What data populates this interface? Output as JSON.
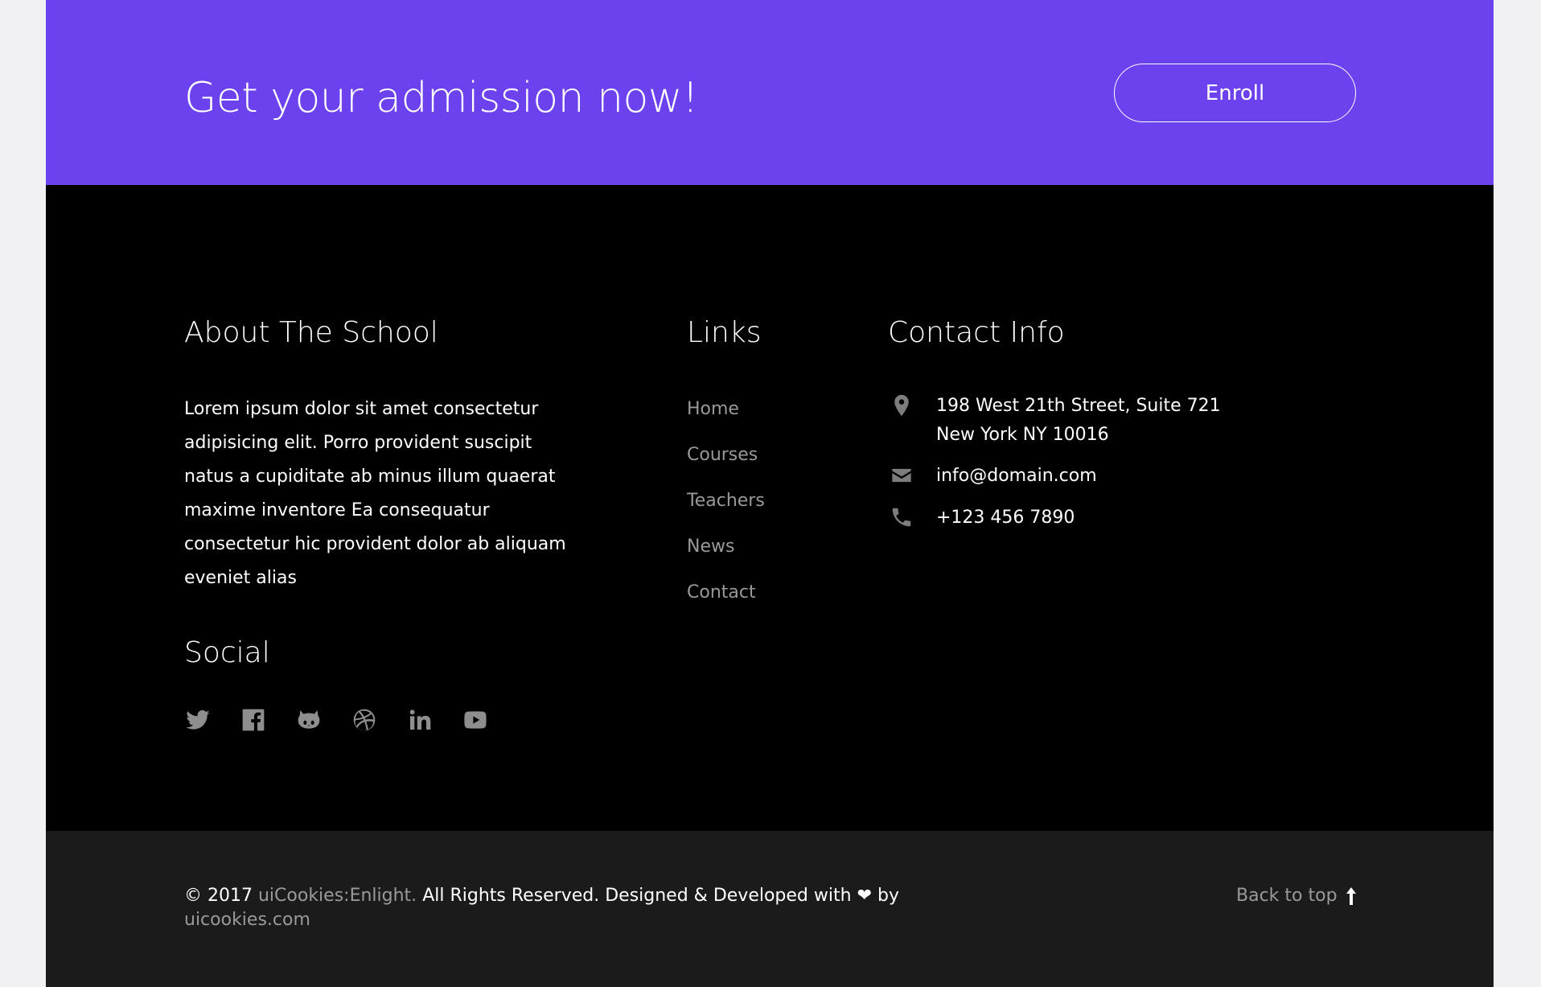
{
  "cta": {
    "title": "Get your admission now!",
    "button_label": "Enroll"
  },
  "about": {
    "heading": "About The School",
    "text": "Lorem ipsum dolor sit amet consectetur adipisicing elit. Porro provident suscipit natus a cupiditate ab minus illum quaerat maxime inventore Ea consequatur consectetur hic provident dolor ab aliquam eveniet alias"
  },
  "social": {
    "heading": "Social",
    "icons": [
      "twitter-icon",
      "facebook-icon",
      "github-icon",
      "dribbble-icon",
      "linkedin-icon",
      "youtube-icon"
    ]
  },
  "links": {
    "heading": "Links",
    "items": [
      "Home",
      "Courses",
      "Teachers",
      "News",
      "Contact"
    ]
  },
  "contact": {
    "heading": "Contact Info",
    "address": "198 West 21th Street, Suite 721 New York NY 10016",
    "email": "info@domain.com",
    "phone": "+123 456 7890"
  },
  "bottom": {
    "copy_prefix": "© 2017",
    "brand": "uiCookies:Enlight.",
    "copy_middle": "All Rights Reserved. Designed & Developed with",
    "copy_by": "by",
    "site": "uicookies.com",
    "back_to_top": "Back to top"
  },
  "colors": {
    "accent": "#6c41ee",
    "footer_bg": "#000000",
    "bottom_bg": "#1b1b1b",
    "page_bg": "#f0f0f3"
  }
}
